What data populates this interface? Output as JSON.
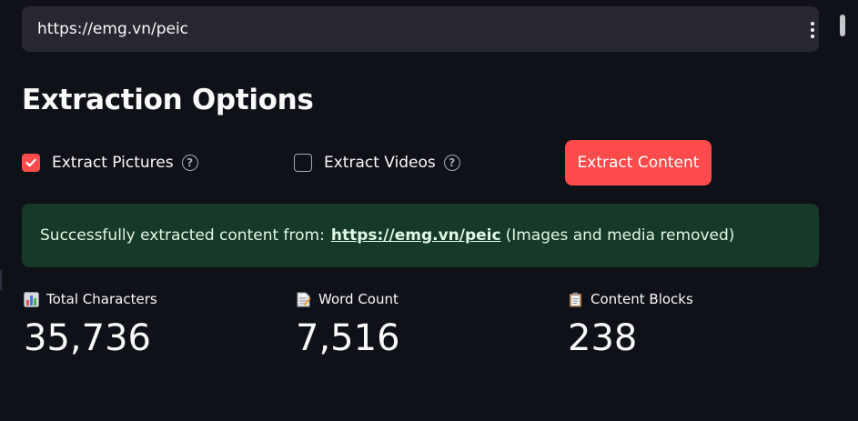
{
  "url_bar": {
    "value": "https://emg.vn/peic",
    "menu_icon": "kebab-menu-icon"
  },
  "heading": "Extraction Options",
  "options": {
    "extract_pictures": {
      "label": "Extract Pictures",
      "checked": true,
      "help_icon": "help-circle-icon"
    },
    "extract_videos": {
      "label": "Extract Videos",
      "checked": false,
      "help_icon": "help-circle-icon"
    }
  },
  "extract_button": {
    "label": "Extract Content"
  },
  "success": {
    "prefix": "Successfully extracted content from:",
    "link": "https://emg.vn/peic",
    "suffix": "(Images and media removed)"
  },
  "metrics": [
    {
      "icon": "bar-chart-icon",
      "label": "Total Characters",
      "value": "35,736"
    },
    {
      "icon": "memo-icon",
      "label": "Word Count",
      "value": "7,516"
    },
    {
      "icon": "clipboard-icon",
      "label": "Content Blocks",
      "value": "238"
    }
  ],
  "colors": {
    "background": "#0e1117",
    "accent": "#ff4b4b",
    "input_bg": "#262730",
    "success_bg": "#173928",
    "success_text": "#dff7e6"
  }
}
